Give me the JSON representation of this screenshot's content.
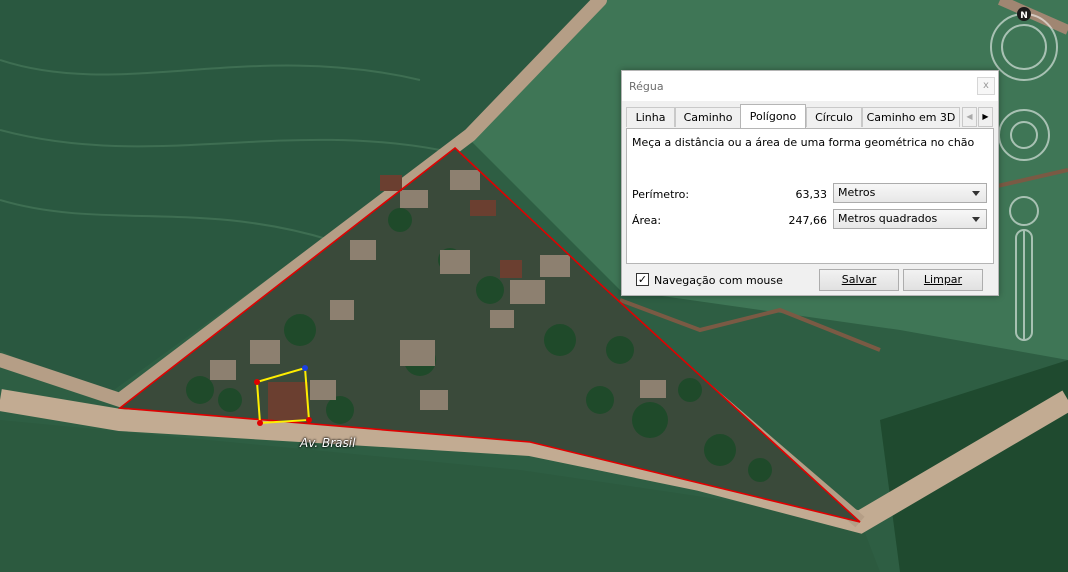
{
  "map": {
    "road_label": "Av. Brasil",
    "compass_label": "N"
  },
  "dialog": {
    "title": "Régua",
    "close_label": "x",
    "tabs": [
      {
        "label": "Linha",
        "active": false
      },
      {
        "label": "Caminho",
        "active": false
      },
      {
        "label": "Polígono",
        "active": true
      },
      {
        "label": "Círculo",
        "active": false
      },
      {
        "label": "Caminho em 3D",
        "active": false
      }
    ],
    "description": "Meça a distância ou a área de uma forma geométrica no chão",
    "perimeter": {
      "label": "Perímetro:",
      "value": "63,33",
      "unit": "Metros"
    },
    "area": {
      "label": "Área:",
      "value": "247,66",
      "unit": "Metros quadrados"
    },
    "mouse_nav": {
      "label": "Navegação com mouse",
      "checked": true
    },
    "save_label": "Salvar",
    "clear_label": "Limpar"
  }
}
